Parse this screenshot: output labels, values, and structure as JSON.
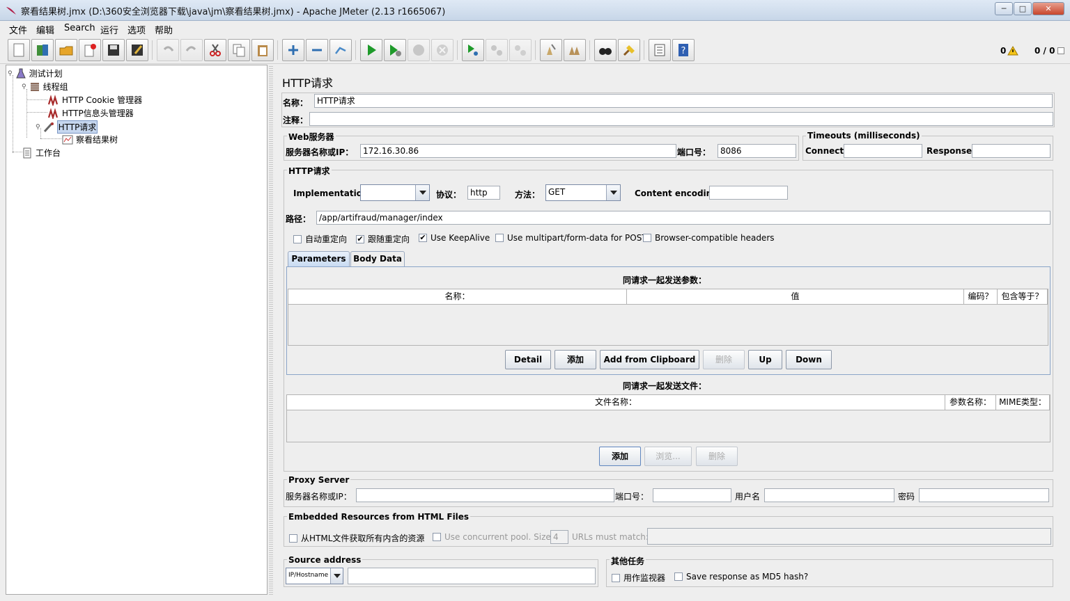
{
  "window": {
    "title": "察看结果树.jmx (D:\\360安全浏览器下载\\java\\jm\\察看结果树.jmx) - Apache JMeter (2.13 r1665067)",
    "minimize": "─",
    "maximize": "□",
    "close": "✕"
  },
  "menu": [
    "文件",
    "编辑",
    "Search",
    "运行",
    "选项",
    "帮助"
  ],
  "toolbar": {
    "icons": [
      "new-icon",
      "templates-icon",
      "open-icon",
      "close-icon",
      "save-icon",
      "save-as-icon",
      "undo-icon",
      "redo-icon",
      "cut-icon",
      "copy-icon",
      "paste-icon",
      "expand-icon",
      "collapse-icon",
      "toggle-icon",
      "start-icon",
      "start-no-pause-icon",
      "stop-icon",
      "shutdown-icon",
      "remote-start-icon",
      "remote-stop-icon",
      "remote-shutdown-icon",
      "clear-icon",
      "clear-all-icon",
      "search-icon",
      "reset-search-icon",
      "function-helper-icon",
      "help-icon"
    ],
    "warnings": "0",
    "threads": "0 / 0"
  },
  "tree": {
    "nodes": [
      {
        "label": "测试计划",
        "icon": "test-plan-icon"
      },
      {
        "label": "线程组",
        "icon": "thread-group-icon"
      },
      {
        "label": "HTTP Cookie 管理器",
        "icon": "config-icon"
      },
      {
        "label": "HTTP信息头管理器",
        "icon": "config-icon"
      },
      {
        "label": "HTTP请求",
        "icon": "sampler-icon"
      },
      {
        "label": "察看结果树",
        "icon": "listener-icon"
      },
      {
        "label": "工作台",
        "icon": "workbench-icon"
      }
    ]
  },
  "panel": {
    "title": "HTTP请求",
    "name_label": "名称：",
    "name_value": "HTTP请求",
    "comment_label": "注释：",
    "comment_value": ""
  },
  "web_server": {
    "legend": "Web服务器",
    "server_label": "服务器名称或IP：",
    "server_value": "172.16.30.86",
    "port_label": "端口号：",
    "port_value": "8086"
  },
  "timeouts": {
    "legend": "Timeouts (milliseconds)",
    "connect_label": "Connect:",
    "connect_value": "",
    "response_label": "Response:",
    "response_value": ""
  },
  "http_request": {
    "legend": "HTTP请求",
    "implementation_label": "Implementation:",
    "implementation_value": "",
    "protocol_label": "协议：",
    "protocol_value": "http",
    "method_label": "方法：",
    "method_value": "GET",
    "encoding_label": "Content encoding:",
    "encoding_value": "",
    "path_label": "路径：",
    "path_value": "/app/artifraud/manager/index",
    "checks": [
      {
        "label": "自动重定向",
        "checked": false
      },
      {
        "label": "跟随重定向",
        "checked": true
      },
      {
        "label": "Use KeepAlive",
        "checked": true
      },
      {
        "label": "Use multipart/form-data for POST",
        "checked": false
      },
      {
        "label": "Browser-compatible headers",
        "checked": false
      }
    ]
  },
  "tabs": [
    {
      "label": "Parameters",
      "active": true
    },
    {
      "label": "Body Data",
      "active": false
    }
  ],
  "params": {
    "caption": "同请求一起发送参数：",
    "columns": [
      "名称：",
      "值",
      "编码？",
      "包含等于？"
    ],
    "buttons": [
      {
        "label": "Detail",
        "enabled": true
      },
      {
        "label": "添加",
        "enabled": true
      },
      {
        "label": "Add from Clipboard",
        "enabled": true
      },
      {
        "label": "删除",
        "enabled": false
      },
      {
        "label": "Up",
        "enabled": true
      },
      {
        "label": "Down",
        "enabled": true
      }
    ]
  },
  "files": {
    "caption": "同请求一起发送文件：",
    "columns": [
      "文件名称：",
      "参数名称：",
      "MIME类型："
    ],
    "buttons": [
      {
        "label": "添加",
        "enabled": true
      },
      {
        "label": "浏览...",
        "enabled": false
      },
      {
        "label": "删除",
        "enabled": false
      }
    ]
  },
  "proxy": {
    "legend": "Proxy Server",
    "server_label": "服务器名称或IP：",
    "port_label": "端口号：",
    "user_label": "用户名",
    "password_label": "密码"
  },
  "embedded": {
    "legend": "Embedded Resources from HTML Files",
    "fetch_label": "从HTML文件获取所有内含的资源",
    "pool_label": "Use concurrent pool. Size:",
    "pool_value": "4",
    "urls_label": "URLs must match:"
  },
  "source": {
    "legend": "Source address",
    "type_value": "IP/Hostname",
    "address_value": ""
  },
  "other": {
    "legend": "其他任务",
    "monitor_label": "用作监视器",
    "md5_label": "Save response as MD5 hash?"
  },
  "colors": {
    "selection": "#c6d7ef",
    "tab_active": "#c9dbf2",
    "panel_bg": "#eeeeee"
  }
}
